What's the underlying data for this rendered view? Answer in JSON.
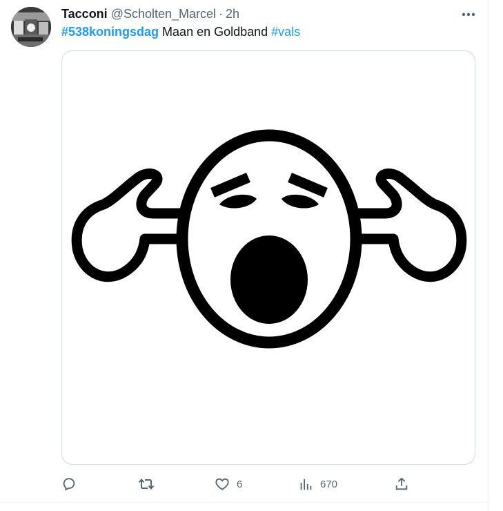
{
  "tweet": {
    "author": {
      "display_name": "Tacconi",
      "handle": "@Scholten_Marcel",
      "separator": "·",
      "time": "2h"
    },
    "text": {
      "hashtag_1": "#538koningsdag",
      "body": " Maan en Goldband ",
      "hashtag_2": "#vals"
    },
    "actions": {
      "reply_count": "",
      "retweet_count": "",
      "like_count": "6",
      "views_count": "670"
    }
  },
  "colors": {
    "text": "#0f1419",
    "secondary": "#536471",
    "hashtag": "#1d9bf0",
    "media_border": "#cfd9de"
  },
  "icons": {
    "more": "more-dots-icon",
    "reply": "reply-icon",
    "retweet": "retweet-icon",
    "like": "heart-icon",
    "views": "views-bar-chart-icon",
    "share": "share-icon"
  }
}
